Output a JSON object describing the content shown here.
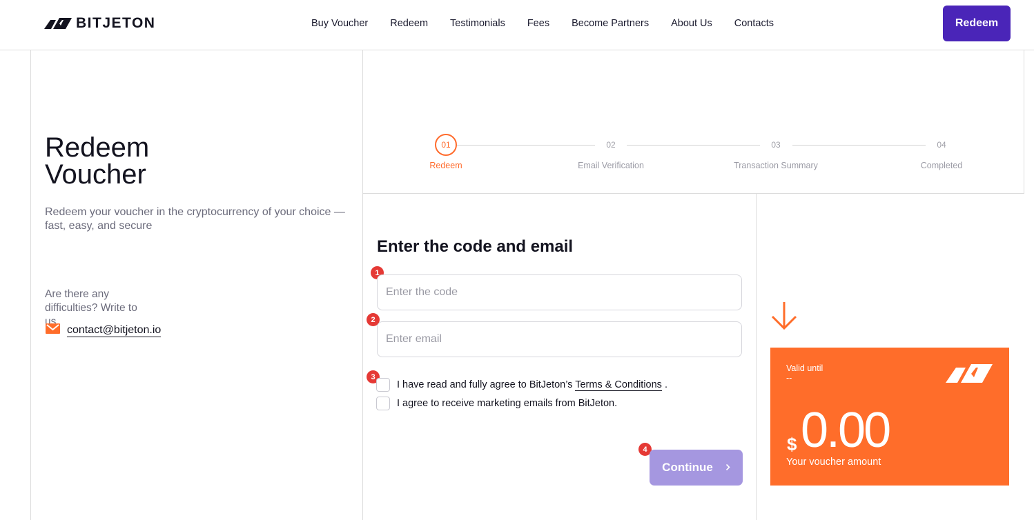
{
  "brand": {
    "name": "BITJETON"
  },
  "nav": {
    "items": [
      "Buy Voucher",
      "Redeem",
      "Testimonials",
      "Fees",
      "Become Partners",
      "About Us",
      "Contacts"
    ],
    "cta_label": "Redeem"
  },
  "hero": {
    "title_line1": "Redeem",
    "title_line2": "Voucher",
    "subtitle": "Redeem your voucher in the cryptocurrency of your choice — fast, easy, and secure",
    "help_text": "Are there any difficulties? Write to us",
    "contact_email": "contact@bitjeton.io"
  },
  "stepper": {
    "current_step": 1,
    "steps": [
      {
        "number": "01",
        "label": "Redeem"
      },
      {
        "number": "02",
        "label": "Email Verification"
      },
      {
        "number": "03",
        "label": "Transaction Summary"
      },
      {
        "number": "04",
        "label": "Completed"
      }
    ]
  },
  "form": {
    "title": "Enter the code and email",
    "code_placeholder": "Enter the code",
    "code_value": "",
    "email_placeholder": "Enter email",
    "email_value": "",
    "terms_prefix": "I have read and fully agree to BitJeton’s ",
    "terms_link": "Terms & Conditions",
    "terms_suffix": " .",
    "marketing_label": "I agree to receive marketing emails from BitJeton.",
    "continue_label": "Continue",
    "badges": [
      "1",
      "2",
      "3",
      "4"
    ]
  },
  "voucher": {
    "valid_label": "Valid until",
    "valid_value": "--",
    "currency_symbol": "$",
    "amount": "0.00",
    "caption": "Your voucher amount"
  },
  "colors": {
    "brand_purple": "#4a25b8",
    "accent_orange": "#ff6d2a",
    "continue_disabled": "#a597e0",
    "badge_red": "#e53935"
  },
  "icons": {
    "logo": "bitjeton-logo-icon",
    "email": "mail-icon",
    "arrow": "arrow-down-icon",
    "chevron": "chevron-right-icon"
  }
}
